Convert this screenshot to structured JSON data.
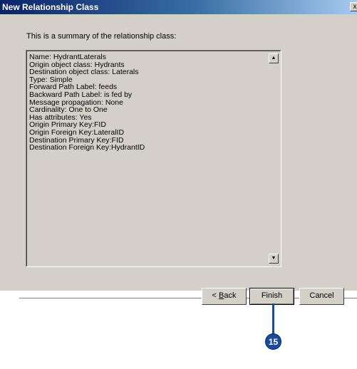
{
  "window": {
    "title": "New Relationship Class",
    "close_glyph": "x"
  },
  "intro_text": "This is a summary of the relationship class:",
  "summary": {
    "lines": [
      "Name: HydrantLaterals",
      "Origin object class: Hydrants",
      "Destination object class: Laterals",
      "Type: Simple",
      "Forward Path Label: feeds",
      "Backward Path Label: is fed by",
      "Message propagation: None",
      "Cardinality: One to One",
      "Has attributes: Yes",
      "Origin Primary Key:FID",
      "Origin Foreign Key:LateralID",
      "Destination Primary Key:FID",
      "Destination Foreign Key:HydrantID"
    ]
  },
  "buttons": {
    "back_prefix": "< ",
    "back_accel": "B",
    "back_rest": "ack",
    "finish": "Finish",
    "cancel": "Cancel"
  },
  "callout": {
    "number": "15"
  },
  "colors": {
    "dialog_bg": "#d4d0c8",
    "titlebar_start": "#0a246a",
    "titlebar_end": "#a6caf0",
    "callout": "#1a4a9c"
  }
}
